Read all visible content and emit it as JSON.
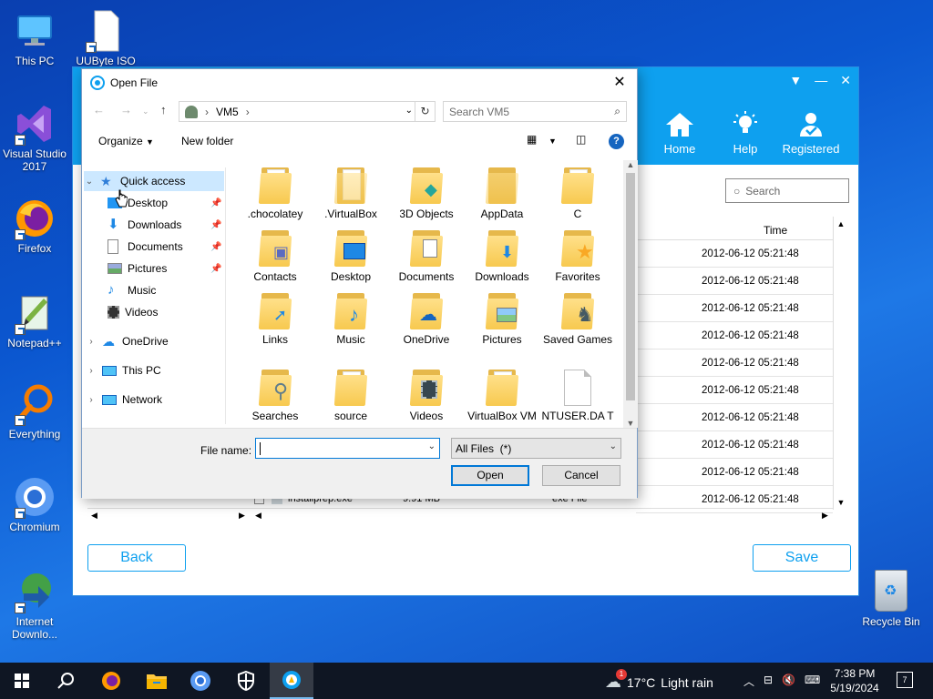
{
  "desktop": {
    "icons": [
      {
        "label": "This PC"
      },
      {
        "label": "UUByte ISO"
      },
      {
        "label": "Visual Studio 2017"
      },
      {
        "label": "Firefox"
      },
      {
        "label": "Notepad++"
      },
      {
        "label": "Everything"
      },
      {
        "label": "Chromium"
      },
      {
        "label": "Internet Downlo..."
      }
    ],
    "recycle_bin": "Recycle Bin"
  },
  "bg_app": {
    "nav": [
      {
        "label": "Home"
      },
      {
        "label": "Help"
      },
      {
        "label": "Registered"
      }
    ],
    "search_placeholder": "Search",
    "col_time": "Time",
    "times": [
      "2012-06-12 05:21:48",
      "2012-06-12 05:21:48",
      "2012-06-12 05:21:48",
      "2012-06-12 05:21:48",
      "2012-06-12 05:21:48",
      "2012-06-12 05:21:48",
      "2012-06-12 05:21:48",
      "2012-06-12 05:21:48",
      "2012-06-12 05:21:48",
      "2012-06-12 05:21:48"
    ],
    "last_row": {
      "name": "installprep.exe",
      "size": "9.91 MB",
      "type": "exe File"
    },
    "back_label": "Back",
    "save_label": "Save",
    "colors": {
      "accent": "#0ea0ef"
    }
  },
  "dialog": {
    "title": "Open File",
    "address": {
      "segment": "VM5"
    },
    "search_placeholder": "Search VM5",
    "toolbar": {
      "organize": "Organize",
      "new_folder": "New folder"
    },
    "nav": {
      "quick_access": "Quick access",
      "pinned": [
        "Desktop",
        "Downloads",
        "Documents",
        "Pictures"
      ],
      "unpinned": [
        "Music",
        "Videos"
      ],
      "onedrive": "OneDrive",
      "this_pc": "This PC",
      "network": "Network"
    },
    "items": [
      {
        "name": ".chocolatey",
        "kind": "folder"
      },
      {
        "name": ".VirtualBox",
        "kind": "folder"
      },
      {
        "name": "3D Objects",
        "kind": "folder"
      },
      {
        "name": "AppData",
        "kind": "folder"
      },
      {
        "name": "C",
        "kind": "folder"
      },
      {
        "name": "Contacts",
        "kind": "folder"
      },
      {
        "name": "Desktop",
        "kind": "folder"
      },
      {
        "name": "Documents",
        "kind": "folder"
      },
      {
        "name": "Downloads",
        "kind": "folder"
      },
      {
        "name": "Favorites",
        "kind": "folder"
      },
      {
        "name": "Links",
        "kind": "folder"
      },
      {
        "name": "Music",
        "kind": "folder"
      },
      {
        "name": "OneDrive",
        "kind": "folder"
      },
      {
        "name": "Pictures",
        "kind": "folder"
      },
      {
        "name": "Saved Games",
        "kind": "folder"
      },
      {
        "name": "Searches",
        "kind": "folder"
      },
      {
        "name": "source",
        "kind": "folder"
      },
      {
        "name": "Videos",
        "kind": "folder"
      },
      {
        "name": "VirtualBox VM",
        "kind": "folder"
      },
      {
        "name": "NTUSER.DA T",
        "kind": "file"
      }
    ],
    "file_name_label": "File name:",
    "file_name_value": "",
    "file_type": "All Files  (*)",
    "open_label": "Open",
    "cancel_label": "Cancel"
  },
  "taskbar": {
    "weather": {
      "temp": "17°C",
      "desc": "Light rain",
      "badge": "1"
    },
    "time": "7:38 PM",
    "date": "5/19/2024",
    "notifications": "7"
  }
}
